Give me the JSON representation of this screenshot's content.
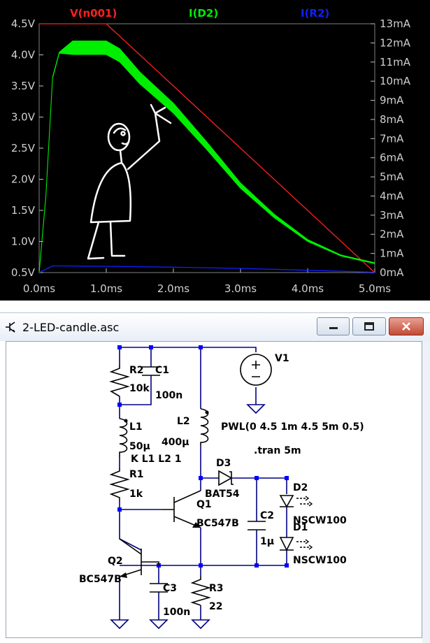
{
  "plot": {
    "traces": [
      {
        "name": "V(n001)",
        "color": "#ff2020"
      },
      {
        "name": "I(D2)",
        "color": "#00ee00"
      },
      {
        "name": "I(R2)",
        "color": "#1020ff"
      }
    ],
    "left_ticks": [
      "4.5V",
      "4.0V",
      "3.5V",
      "3.0V",
      "2.5V",
      "2.0V",
      "1.5V",
      "1.0V",
      "0.5V"
    ],
    "right_ticks": [
      "13mA",
      "12mA",
      "11mA",
      "10mA",
      "9mA",
      "8mA",
      "7mA",
      "6mA",
      "5mA",
      "4mA",
      "3mA",
      "2mA",
      "1mA",
      "0mA"
    ],
    "x_ticks": [
      "0.0ms",
      "1.0ms",
      "2.0ms",
      "3.0ms",
      "4.0ms",
      "5.0ms"
    ]
  },
  "chart_data": {
    "type": "line",
    "xlabel": "",
    "x_unit": "ms",
    "xlim": [
      0,
      5
    ],
    "ylim_left": [
      0.5,
      4.5
    ],
    "ylim_right": [
      0,
      13
    ],
    "series": [
      {
        "name": "V(n001)",
        "axis": "left",
        "unit": "V",
        "x": [
          0,
          1.0,
          5.0
        ],
        "y": [
          4.5,
          4.5,
          0.5
        ]
      },
      {
        "name": "I(D2)",
        "axis": "right",
        "unit": "mA",
        "x": [
          0,
          0.1,
          0.2,
          0.3,
          0.5,
          1.0,
          1.2,
          1.5,
          2.0,
          2.5,
          3.0,
          3.5,
          4.0,
          4.5,
          5.0
        ],
        "y": [
          0,
          4,
          10.2,
          11.5,
          11.9,
          11.9,
          11.5,
          10.3,
          8.7,
          6.7,
          4.6,
          3.0,
          1.7,
          0.9,
          0.5
        ]
      },
      {
        "name": "I(R2)",
        "axis": "right",
        "unit": "mA",
        "x": [
          0,
          0.2,
          1.0,
          2.0,
          3.0,
          4.0,
          5.0
        ],
        "y": [
          0.0,
          0.35,
          0.33,
          0.28,
          0.22,
          0.12,
          0.02
        ]
      }
    ]
  },
  "window": {
    "title": "2-LED-candle.asc"
  },
  "schematic": {
    "components": {
      "R2": {
        "ref": "R2",
        "value": "10k"
      },
      "C1": {
        "ref": "C1",
        "value": "100n"
      },
      "V1": {
        "ref": "V1"
      },
      "L1": {
        "ref": "L1",
        "value": "50µ"
      },
      "L2": {
        "ref": "L2",
        "value": "400µ"
      },
      "coupling": "K L1 L2 1",
      "R1": {
        "ref": "R1",
        "value": "1k"
      },
      "D3": {
        "ref": "D3",
        "value": "BAT54"
      },
      "Q1": {
        "ref": "Q1",
        "value": "BC547B"
      },
      "C2": {
        "ref": "C2",
        "value": "1µ"
      },
      "D2": {
        "ref": "D2",
        "value": "NSCW100"
      },
      "D1": {
        "ref": "D1",
        "value": "NSCW100"
      },
      "Q2": {
        "ref": "Q2",
        "value": "BC547B"
      },
      "C3": {
        "ref": "C3",
        "value": "100n"
      },
      "R3": {
        "ref": "R3",
        "value": "22"
      }
    },
    "source_spec": "PWL(0 4.5 1m 4.5 5m 0.5)",
    "directive": ".tran 5m"
  }
}
